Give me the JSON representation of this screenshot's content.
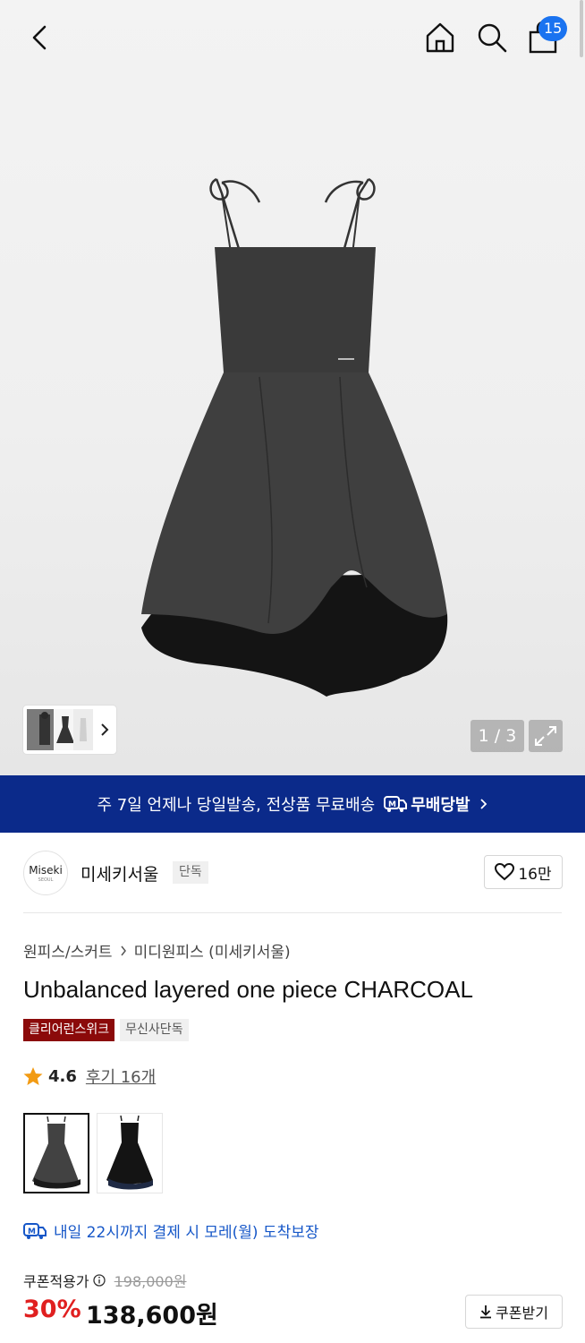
{
  "header": {
    "cart_count": "15",
    "icons": [
      "back-arrow-icon",
      "home-icon",
      "search-icon",
      "cart-bag-icon"
    ]
  },
  "gallery": {
    "pager": "1 / 3"
  },
  "banner": {
    "text": "주 7일 언제나 당일발송, 전상품 무료배송",
    "logo_label": "무배당발",
    "background": "#0b2a8a"
  },
  "brand": {
    "logo_text": "Miseki",
    "logo_subtext": "SEOUL",
    "name": "미세키서울",
    "tag": "단독",
    "likes": "16만"
  },
  "product": {
    "breadcrumb": [
      "원피스/스커트",
      "미디원피스 (미세키서울)"
    ],
    "title": "Unbalanced layered one piece CHARCOAL",
    "badges": [
      "클리어런스위크",
      "무신사단독"
    ],
    "rating": "4.6",
    "reviews": "후기 16개",
    "colors": [
      {
        "name": "charcoal",
        "selected": true
      },
      {
        "name": "black",
        "selected": false
      }
    ]
  },
  "delivery": {
    "text": "내일 22시까지 결제 시 모레(월) 도착보장",
    "color": "#1657c8"
  },
  "price": {
    "label": "쿠폰적용가",
    "original": "198,000원",
    "discount": "30%",
    "final": "138,600원",
    "coupon_button": "쿠폰받기",
    "discount_color": "#e02020"
  }
}
